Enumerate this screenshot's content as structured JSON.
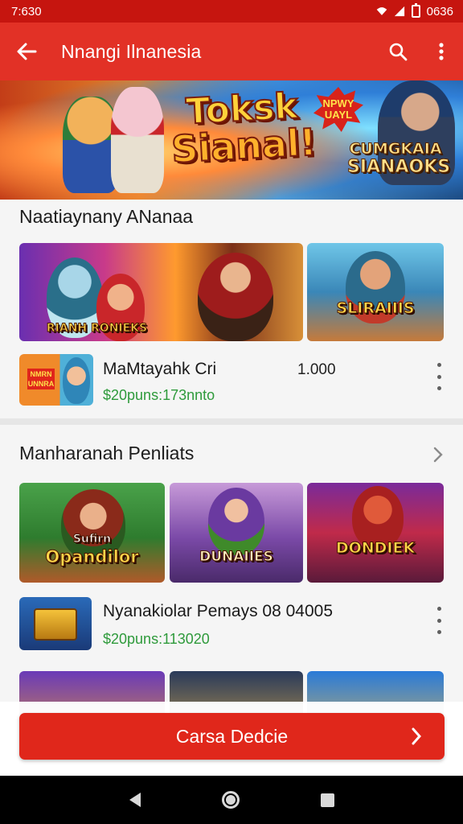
{
  "status_bar": {
    "time": "7:630",
    "clock_right": "0636"
  },
  "app_bar": {
    "title": "Nnangi Ilnanesia"
  },
  "hero": {
    "logo_line1": "Toksk",
    "logo_line2": "Sianal!",
    "badge_line1": "NPWY",
    "badge_line2": "UAYL",
    "side_line1": "CUMGKAIA",
    "side_line2": "SIANAOKS"
  },
  "section1": {
    "title": "Naatiaynany ANanaa",
    "tiles": [
      {
        "label": "RIANH RONIEKS"
      },
      {
        "label": "SLIRAIIIS"
      }
    ],
    "item": {
      "name": "MaMtayahk Cri",
      "count": "1.000",
      "price": "$20puns:173nnto",
      "thumb_label": "NMRN UNNRA"
    }
  },
  "section2": {
    "title": "Manharanah Penliats",
    "tiles": [
      {
        "label": "Opandilor",
        "top": "Sufirn"
      },
      {
        "label": "DUNAIIES"
      },
      {
        "label": "DONDIEK"
      }
    ],
    "item": {
      "name": "Nyanakiolar Pemays 08 04005",
      "price": "$20puns:113020"
    }
  },
  "cta": {
    "label": "Carsa Dedcie"
  },
  "colors": {
    "primary": "#e23126",
    "status": "#c6150f",
    "price_green": "#2e9a3b"
  }
}
